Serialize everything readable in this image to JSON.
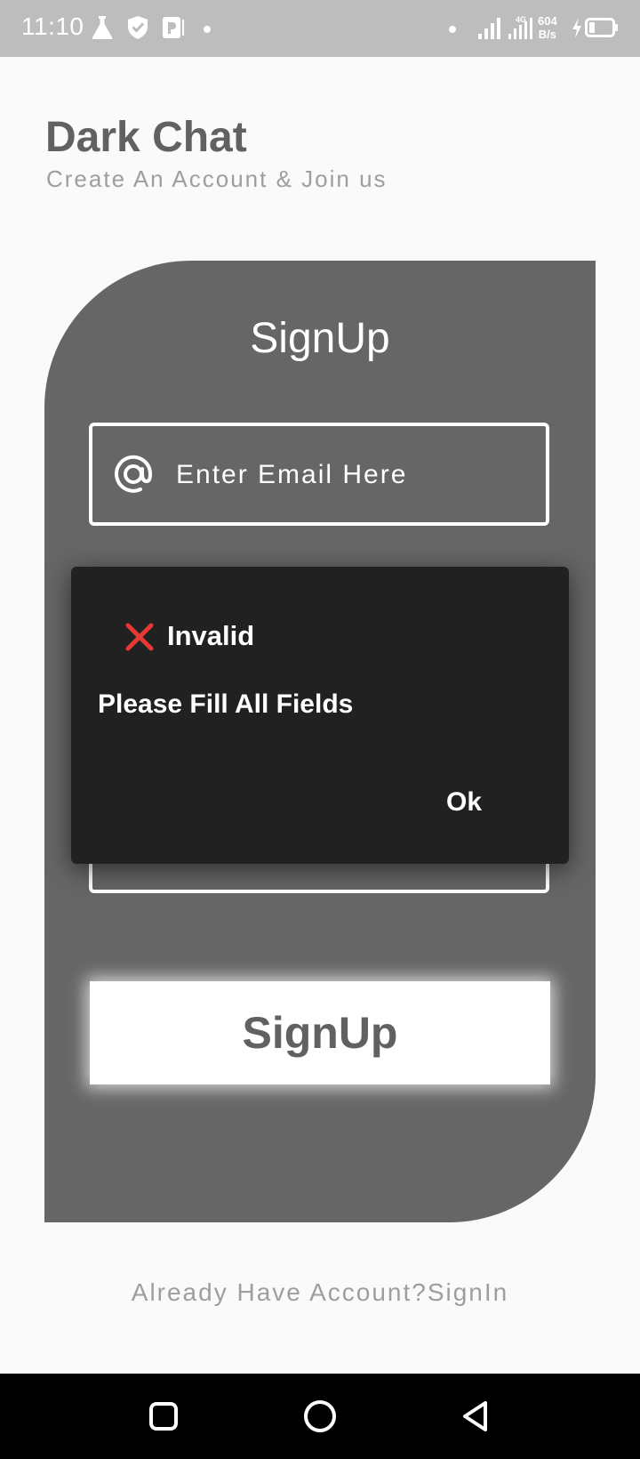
{
  "status_bar": {
    "time": "11:10",
    "network_type": "4G",
    "speed_value": "604",
    "speed_unit": "B/s",
    "icons_left": [
      "flask-icon",
      "shield-check-icon",
      "parking-icon",
      "dot-icon"
    ],
    "icons_right": [
      "dot-icon",
      "signal-icon",
      "signal-4g-icon",
      "charging-icon",
      "battery-icon"
    ]
  },
  "header": {
    "title": "Dark Chat",
    "subtitle": "Create An Account & Join us"
  },
  "card": {
    "title": "SignUp",
    "email_placeholder": "Enter Email Here",
    "email_icon": "at-icon",
    "signup_button_label": "SignUp"
  },
  "signin_link": "Already Have Account?SignIn",
  "dialog": {
    "icon": "close-icon",
    "title": "Invalid",
    "message": "Please Fill All Fields",
    "ok_label": "Ok"
  },
  "nav_bar": {
    "buttons": [
      "recents-icon",
      "home-icon",
      "back-icon"
    ]
  },
  "colors": {
    "background": "#fafafa",
    "status_bar": "#bdbdbd",
    "card": "#666666",
    "dialog": "#212121",
    "error_red": "#e53935",
    "title_text": "#616161",
    "muted_text": "#9e9e9e"
  }
}
